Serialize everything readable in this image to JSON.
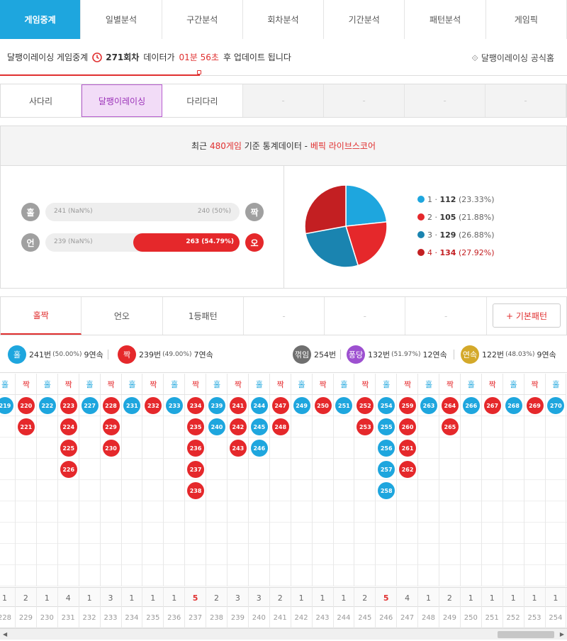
{
  "top_tabs": [
    "게임중계",
    "일별분석",
    "구간분석",
    "회차분석",
    "기간분석",
    "패턴분석",
    "게임픽"
  ],
  "info": {
    "prefix": "달팽이레이싱 게임중계",
    "round": "271회차",
    "mid": "데이터가",
    "time": "01분 56초",
    "suffix": "후 업데이트 됩니다",
    "official": "달팽이레이싱 공식홈"
  },
  "game_tabs": [
    "사다리",
    "달팽이레이싱",
    "다리다리",
    "-",
    "-",
    "-",
    "-"
  ],
  "stat_head": {
    "a": "최근",
    "count": "480게임",
    "b": "기준 통계데이터 -",
    "brand": "베픽 라이브스코어"
  },
  "bars": [
    {
      "left_icon": "홀",
      "left": "241 (NaN%)",
      "right": "240 (50%)",
      "right_icon": "짝",
      "fill_pct": 0
    },
    {
      "left_icon": "언",
      "left": "239 (NaN%)",
      "right": "263 (54.79%)",
      "right_icon": "오",
      "fill_pct": 54.79
    }
  ],
  "chart_data": {
    "type": "pie",
    "slices": [
      {
        "label": "1",
        "count": "112",
        "pct": "(23.33%)",
        "value": 23.33,
        "color": "#1ea6de"
      },
      {
        "label": "2",
        "count": "105",
        "pct": "(21.88%)",
        "value": 21.88,
        "color": "#e5282b"
      },
      {
        "label": "3",
        "count": "129",
        "pct": "(26.88%)",
        "value": 26.88,
        "color": "#1a84b0"
      },
      {
        "label": "4",
        "count": "134",
        "pct": "(27.92%)",
        "value": 27.92,
        "color": "#c31f22"
      }
    ]
  },
  "pattern_tabs": [
    "홀짝",
    "언오",
    "1등패턴",
    "-",
    "-",
    "-"
  ],
  "basic_btn": "+ 기본패턴",
  "summary": [
    {
      "icon": "홀",
      "text": "241번",
      "pct": "(50.00%)",
      "streak": "9연속"
    },
    {
      "icon": "짝",
      "text": "239번",
      "pct": "(49.00%)",
      "streak": "7연속"
    },
    {
      "icon": "꺾임",
      "text": "254번"
    },
    {
      "icon": "퐁당",
      "text": "132번",
      "pct": "(51.97%)",
      "streak": "12연속"
    },
    {
      "icon": "연속",
      "text": "122번",
      "pct": "(48.03%)",
      "streak": "9연속"
    }
  ],
  "columns": [
    {
      "h": "홀",
      "t": "o",
      "b": [
        "219"
      ],
      "c": "1",
      "n": "228"
    },
    {
      "h": "짝",
      "t": "e",
      "b": [
        "220",
        "221"
      ],
      "c": "2",
      "n": "229"
    },
    {
      "h": "홀",
      "t": "o",
      "b": [
        "222"
      ],
      "c": "1",
      "n": "230"
    },
    {
      "h": "짝",
      "t": "e",
      "b": [
        "223",
        "224",
        "225",
        "226"
      ],
      "c": "4",
      "n": "231"
    },
    {
      "h": "홀",
      "t": "o",
      "b": [
        "227"
      ],
      "c": "1",
      "n": "232"
    },
    {
      "h": "짝",
      "t": "e",
      "b": [
        "228",
        "229",
        "230"
      ],
      "c": "3",
      "n": "233"
    },
    {
      "h": "홀",
      "t": "o",
      "b": [
        "231"
      ],
      "c": "1",
      "n": "234"
    },
    {
      "h": "짝",
      "t": "e",
      "b": [
        "232"
      ],
      "c": "1",
      "n": "235"
    },
    {
      "h": "홀",
      "t": "o",
      "b": [
        "233"
      ],
      "c": "1",
      "n": "236"
    },
    {
      "h": "짝",
      "t": "e",
      "b": [
        "234",
        "235",
        "236",
        "237",
        "238"
      ],
      "c": "5",
      "n": "237"
    },
    {
      "h": "홀",
      "t": "o",
      "b": [
        "239",
        "240"
      ],
      "c": "2",
      "n": "238"
    },
    {
      "h": "짝",
      "t": "e",
      "b": [
        "241",
        "242",
        "243"
      ],
      "c": "3",
      "n": "239"
    },
    {
      "h": "홀",
      "t": "o",
      "b": [
        "244",
        "245",
        "246"
      ],
      "c": "3",
      "n": "240"
    },
    {
      "h": "짝",
      "t": "e",
      "b": [
        "247",
        "248"
      ],
      "c": "2",
      "n": "241"
    },
    {
      "h": "홀",
      "t": "o",
      "b": [
        "249"
      ],
      "c": "1",
      "n": "242"
    },
    {
      "h": "짝",
      "t": "e",
      "b": [
        "250"
      ],
      "c": "1",
      "n": "243"
    },
    {
      "h": "홀",
      "t": "o",
      "b": [
        "251"
      ],
      "c": "1",
      "n": "244"
    },
    {
      "h": "짝",
      "t": "e",
      "b": [
        "252",
        "253"
      ],
      "c": "2",
      "n": "245"
    },
    {
      "h": "홀",
      "t": "o",
      "b": [
        "254",
        "255",
        "256",
        "257",
        "258"
      ],
      "c": "5",
      "n": "246"
    },
    {
      "h": "짝",
      "t": "e",
      "b": [
        "259",
        "260",
        "261",
        "262"
      ],
      "c": "4",
      "n": "247"
    },
    {
      "h": "홀",
      "t": "o",
      "b": [
        "263"
      ],
      "c": "1",
      "n": "248"
    },
    {
      "h": "짝",
      "t": "e",
      "b": [
        "264",
        "265"
      ],
      "c": "2",
      "n": "249"
    },
    {
      "h": "홀",
      "t": "o",
      "b": [
        "266"
      ],
      "c": "1",
      "n": "250"
    },
    {
      "h": "짝",
      "t": "e",
      "b": [
        "267"
      ],
      "c": "1",
      "n": "251"
    },
    {
      "h": "홀",
      "t": "o",
      "b": [
        "268"
      ],
      "c": "1",
      "n": "252"
    },
    {
      "h": "짝",
      "t": "e",
      "b": [
        "269"
      ],
      "c": "1",
      "n": "253"
    },
    {
      "h": "홀",
      "t": "o",
      "b": [
        "270"
      ],
      "c": "1",
      "n": "254"
    }
  ],
  "colors": {
    "accent": "#1ea6de",
    "red": "#e5282b",
    "purple": "#9a30b8",
    "gray": "#6f6f6f",
    "gold": "#d4a92a"
  }
}
